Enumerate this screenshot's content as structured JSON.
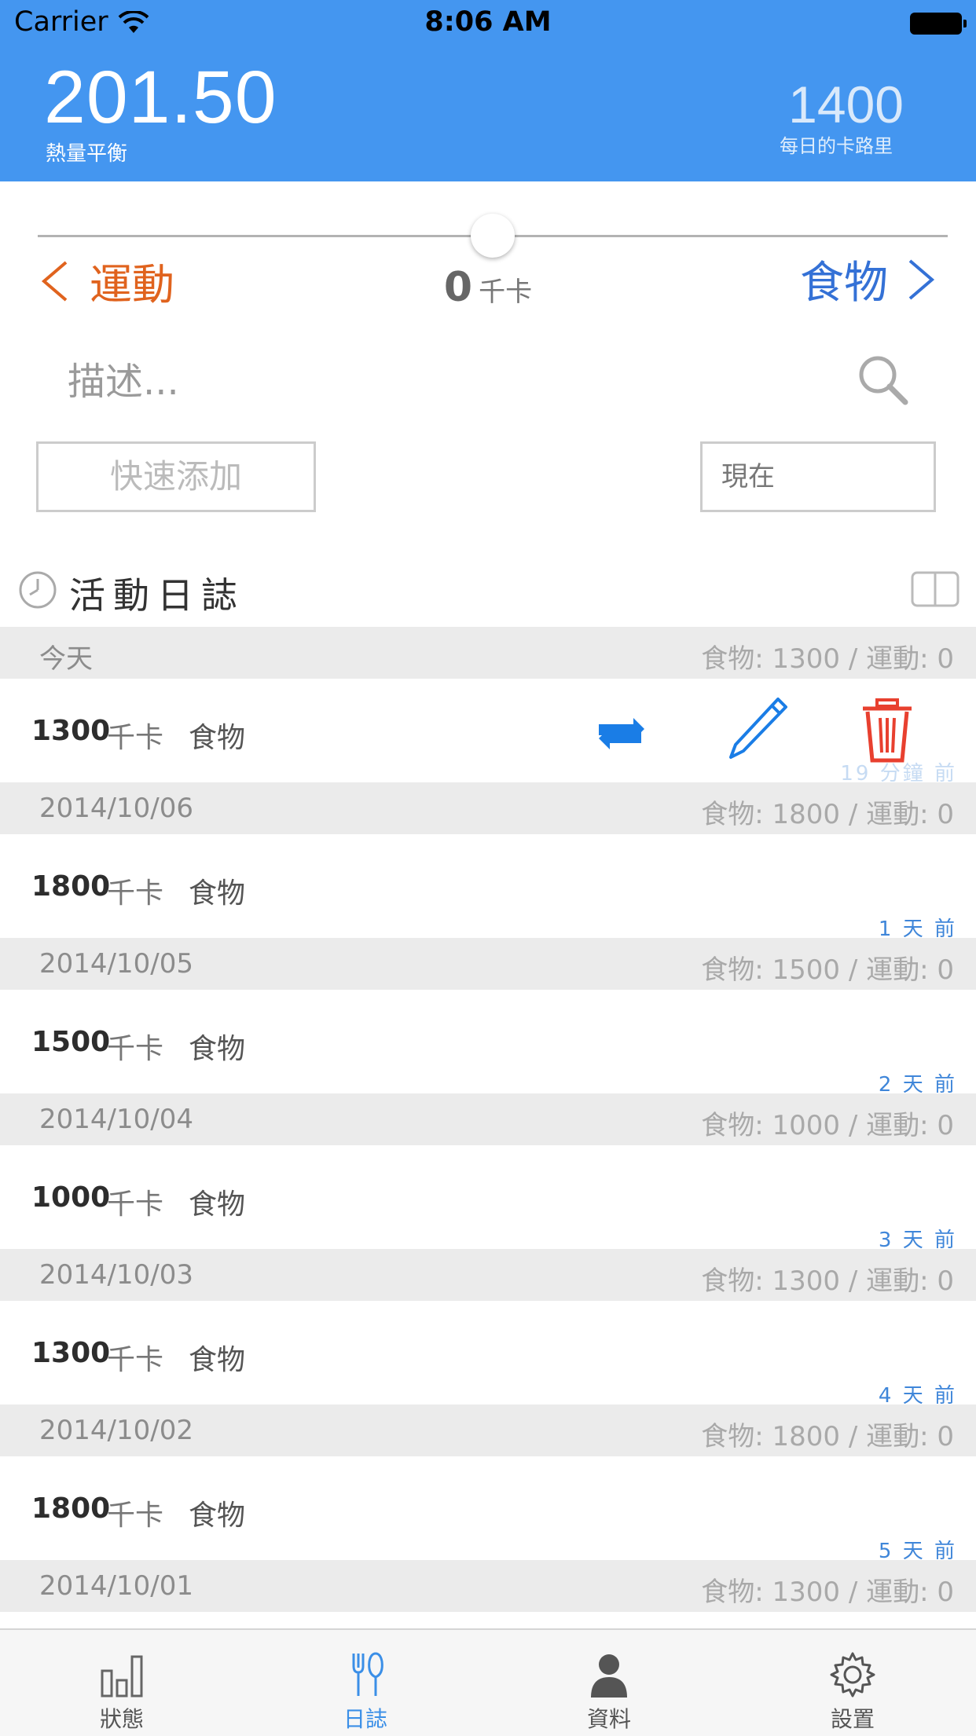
{
  "status_bar": {
    "carrier": "Carrier",
    "time": "8:06 AM"
  },
  "header": {
    "balance_value": "201.50",
    "balance_label": "熱量平衡",
    "daily_value": "1400",
    "daily_label": "每日的卡路里"
  },
  "slider": {
    "level": 0.5,
    "left_label": "運動",
    "right_label": "食物",
    "value": "0",
    "unit": "千卡"
  },
  "entry_form": {
    "description_placeholder": "描述...",
    "quick_add_label": "快速添加",
    "time_value": "現在"
  },
  "log": {
    "title": "活動日誌",
    "days": [
      {
        "date": "今天",
        "totals": "食物: 1300 / 運動: 0",
        "kcal": "1300",
        "unit": "千卡",
        "type": "食物",
        "ago": "19 分鐘 前"
      },
      {
        "date": "2014/10/06",
        "totals": "食物: 1800 / 運動: 0",
        "kcal": "1800",
        "unit": "千卡",
        "type": "食物",
        "ago": "1 天 前"
      },
      {
        "date": "2014/10/05",
        "totals": "食物: 1500 / 運動: 0",
        "kcal": "1500",
        "unit": "千卡",
        "type": "食物",
        "ago": "2 天 前"
      },
      {
        "date": "2014/10/04",
        "totals": "食物: 1000 / 運動: 0",
        "kcal": "1000",
        "unit": "千卡",
        "type": "食物",
        "ago": "3 天 前"
      },
      {
        "date": "2014/10/03",
        "totals": "食物: 1300 / 運動: 0",
        "kcal": "1300",
        "unit": "千卡",
        "type": "食物",
        "ago": "4 天 前"
      },
      {
        "date": "2014/10/02",
        "totals": "食物: 1800 / 運動: 0",
        "kcal": "1800",
        "unit": "千卡",
        "type": "食物",
        "ago": "5 天 前"
      },
      {
        "date": "2014/10/01",
        "totals": "食物: 1300 / 運動: 0"
      }
    ]
  },
  "tabs": [
    {
      "label": "狀態",
      "icon": "bar-chart-icon"
    },
    {
      "label": "日誌",
      "icon": "fork-knife-icon",
      "active": true
    },
    {
      "label": "資料",
      "icon": "person-icon"
    },
    {
      "label": "設置",
      "icon": "gear-icon"
    }
  ],
  "colors": {
    "header": "#4496f0",
    "exercise": "#e0631e",
    "food": "#3471d6",
    "delete": "#e8402f",
    "action_blue": "#1a7de6"
  }
}
